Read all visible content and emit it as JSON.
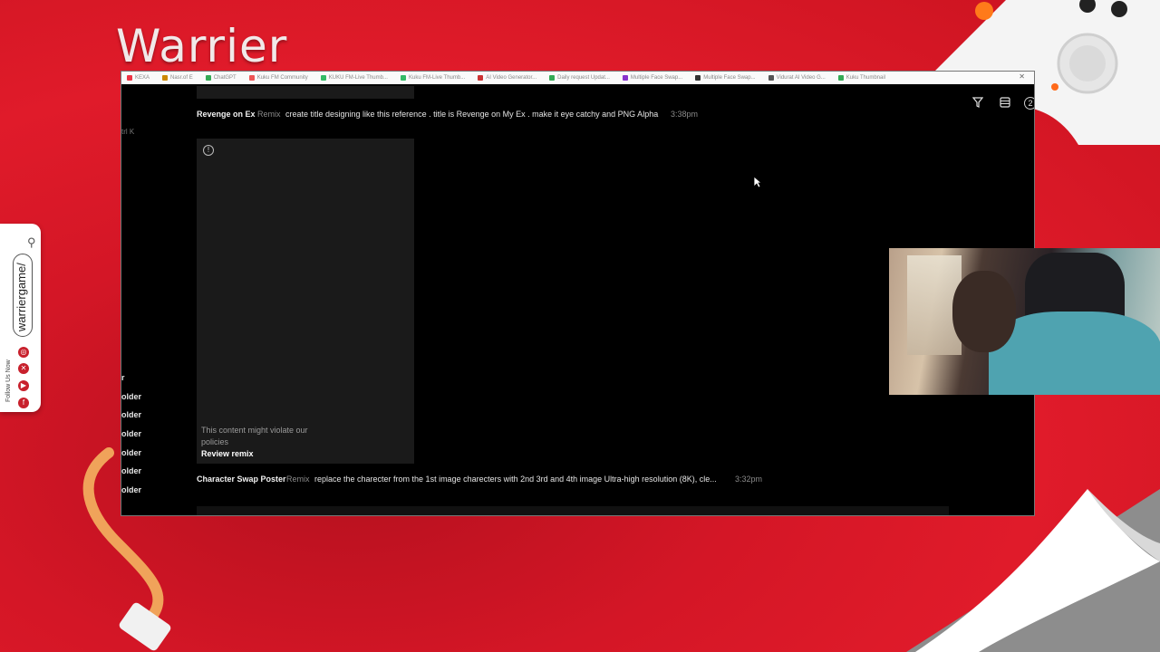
{
  "brand": {
    "title": "Warrier"
  },
  "social": {
    "handle": "warriergame/",
    "follow_label": "Follow Us Now",
    "icons": [
      "instagram-icon",
      "x-icon",
      "youtube-icon",
      "facebook-icon"
    ]
  },
  "bookmarks": [
    "KEXA",
    "Nasr.of E",
    "ChatGPT",
    "Kuku FM Community",
    "KUKU FM-Live Thumb...",
    "Kuku FM-Live Thumb...",
    "AI Video Generator...",
    "Daily request Updat...",
    "Multiple Face Swap...",
    "Multiple Face Swap...",
    "Vidurat AI Video G...",
    "Kuku Thumbnail"
  ],
  "app": {
    "ctrl_k": "trl K",
    "rows": [
      {
        "title": "Revenge on Ex",
        "tag": "Remix",
        "prompt": "create title designing like this reference . title is Revenge on My Ex . make it eye catchy and PNG Alpha",
        "time": "3:38pm"
      },
      {
        "title": "Character Swap Poster",
        "tag": "Remix",
        "prompt": "replace the charecter from the 1st image charecters with 2nd 3rd and 4th image Ultra-high resolution (8K), cle...",
        "time": "3:32pm"
      }
    ],
    "card": {
      "message": "This content might violate our policies",
      "action": "Review remix"
    },
    "sidebar_items": [
      "r",
      "older",
      "older",
      "older",
      "older",
      "older",
      "older"
    ],
    "toolbar": {
      "badge": "2"
    }
  },
  "colors": {
    "background": "#e01b2a",
    "screen": "#000000",
    "card": "#1a1a1a"
  }
}
